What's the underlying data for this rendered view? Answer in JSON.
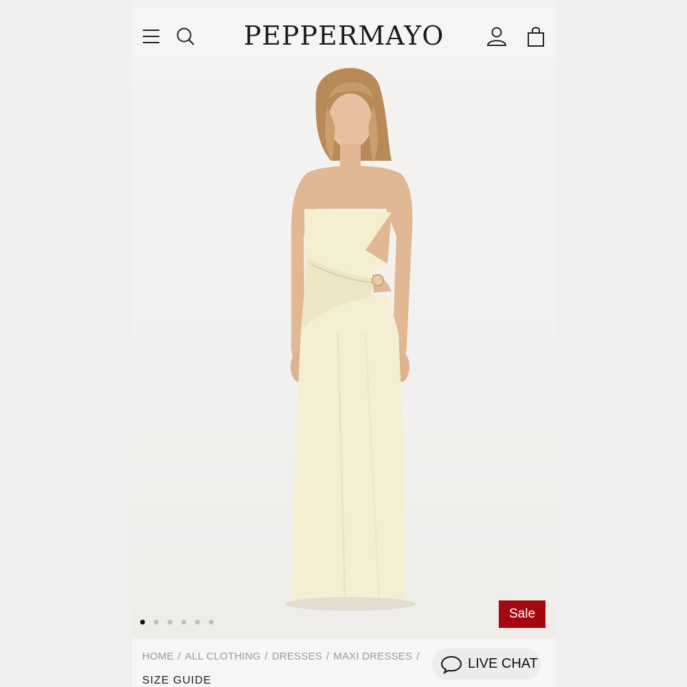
{
  "brand": {
    "logo_text": "PEPPERMAYO"
  },
  "header": {
    "icons": [
      "menu-icon",
      "search-icon",
      "account-icon",
      "bag-icon"
    ]
  },
  "hero": {
    "image_subject": "model-in-cream-strapless-maxi-dress",
    "carousel_count": 6,
    "active_index": 0
  },
  "badge": {
    "label": "Sale",
    "color": "#a4080f"
  },
  "breadcrumb": {
    "items": [
      "HOME",
      "ALL CLOTHING",
      "DRESSES",
      "MAXI DRESSES"
    ],
    "separator": "/"
  },
  "links": {
    "size_guide": "SIZE GUIDE"
  },
  "chat": {
    "label": "LIVE CHAT"
  }
}
